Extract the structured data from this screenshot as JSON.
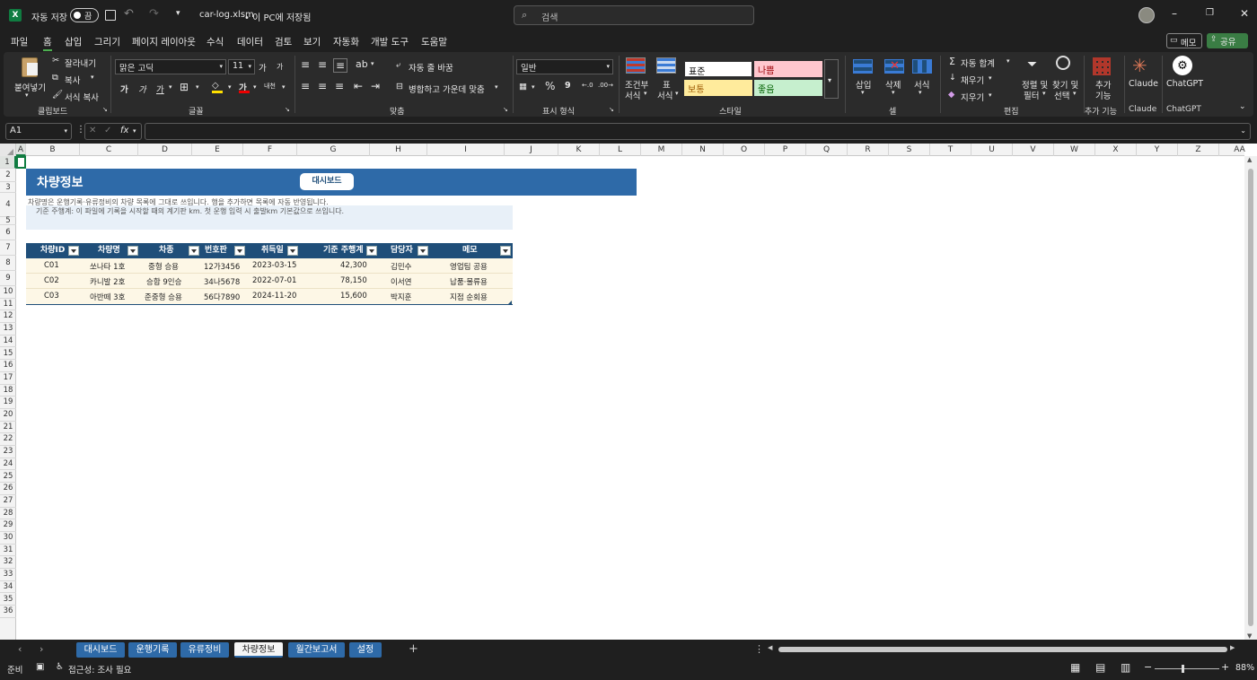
{
  "title_bar": {
    "autosave_label": "자동 저장",
    "toggle_state": "끔",
    "file_name": "car-log.xlsm",
    "save_status": "• 이 PC에 저장됨",
    "search_placeholder": "검색"
  },
  "menu": {
    "tabs": [
      "파일",
      "홈",
      "삽입",
      "그리기",
      "페이지 레이아웃",
      "수식",
      "데이터",
      "검토",
      "보기",
      "자동화",
      "개발 도구",
      "도움말"
    ],
    "active": "홈",
    "memo": "메모",
    "share": "공유"
  },
  "ribbon": {
    "clipboard": {
      "paste": "붙여넣기",
      "cut": "잘라내기",
      "copy": "복사",
      "format_painter": "서식 복사",
      "label": "클립보드"
    },
    "font": {
      "name": "맑은 고딕",
      "size": "11",
      "grow": "가",
      "shrink": "가",
      "bold": "가",
      "italic": "가",
      "underline": "가",
      "color_letter": "가",
      "phonetic": "내천",
      "label": "글꼴"
    },
    "alignment": {
      "wrap": "자동 줄 바꿈",
      "merge": "병합하고 가운데 맞춤",
      "label": "맞춤"
    },
    "number": {
      "format": "일반",
      "percent": "%",
      "comma": "9",
      "label": "표시 형식"
    },
    "styles": {
      "conditional_line1": "조건부",
      "conditional_line2": "서식",
      "table_line1": "표",
      "table_line2": "서식",
      "normal": "표준",
      "bad": "나쁨",
      "neutral": "보통",
      "good": "좋음",
      "label": "스타일"
    },
    "cells": {
      "insert": "삽입",
      "delete": "삭제",
      "format": "서식",
      "label": "셀"
    },
    "editing": {
      "autosum": "자동 합계",
      "fill": "채우기",
      "clear": "지우기",
      "sort_line1": "정렬 및",
      "sort_line2": "필터",
      "find_line1": "찾기 및",
      "find_line2": "선택",
      "label": "편집"
    },
    "addins": {
      "line1": "추가",
      "line2": "기능",
      "label": "추가 기능"
    },
    "claude": {
      "name": "Claude",
      "label": "Claude"
    },
    "chatgpt": {
      "name": "ChatGPT",
      "label": "ChatGPT"
    }
  },
  "formula_bar": {
    "name_box": "A1",
    "fx": "fx",
    "value": ""
  },
  "columns": [
    "A",
    "B",
    "C",
    "D",
    "E",
    "F",
    "G",
    "H",
    "I",
    "J",
    "K",
    "L",
    "M",
    "N",
    "O",
    "P",
    "Q",
    "R",
    "S",
    "T",
    "U",
    "V",
    "W",
    "X",
    "Y",
    "Z",
    "AA"
  ],
  "rows": [
    "1",
    "2",
    "3",
    "4",
    "5",
    "6",
    "7",
    "8",
    "9",
    "10",
    "11",
    "12",
    "13",
    "14",
    "15",
    "16",
    "17",
    "18",
    "19",
    "20",
    "21",
    "22",
    "23",
    "24",
    "25",
    "26",
    "27",
    "28",
    "29",
    "30",
    "31",
    "32",
    "33",
    "34",
    "35",
    "36"
  ],
  "sheet": {
    "title": "차량정보",
    "dashboard_button": "대시보드",
    "note_line1": "차량명은 운행기록·유류정비의 차량 목록에 그대로 쓰입니다. 행을 추가하면 목록에 자동 반영됩니다.",
    "note_line2": "기준 주행계: 이 파일에 기록을 시작할 때의 계기판 km. 첫 운행 입력 시 출발km 기본값으로 쓰입니다.",
    "table": {
      "headers": [
        "차량ID",
        "차량명",
        "차종",
        "번호판",
        "취득일",
        "기준 주행계",
        "담당자",
        "메모"
      ],
      "rows": [
        [
          "C01",
          "쏘나타 1호",
          "중형 승용",
          "12가3456",
          "2023-03-15",
          "42,300",
          "김민수",
          "영업팀 공용"
        ],
        [
          "C02",
          "카니발 2호",
          "승합 9인승",
          "34나5678",
          "2022-07-01",
          "78,150",
          "이서연",
          "납품·물류용"
        ],
        [
          "C03",
          "아반떼 3호",
          "준중형 승용",
          "56다7890",
          "2024-11-20",
          "15,600",
          "박지훈",
          "지점 순회용"
        ]
      ]
    }
  },
  "tabs": {
    "items": [
      "대시보드",
      "운행기록",
      "유류정비",
      "차량정보",
      "월간보고서",
      "설정"
    ],
    "active": "차량정보",
    "add": "+"
  },
  "status": {
    "ready": "준비",
    "accessibility": "접근성: 조사 필요",
    "zoom": "88%"
  },
  "colors": {
    "header_blue": "#2e6aa8",
    "table_header": "#1f4e79",
    "band": "#fdf7e6",
    "note_bg": "#e8f0f8",
    "accent_green": "#33a852"
  }
}
